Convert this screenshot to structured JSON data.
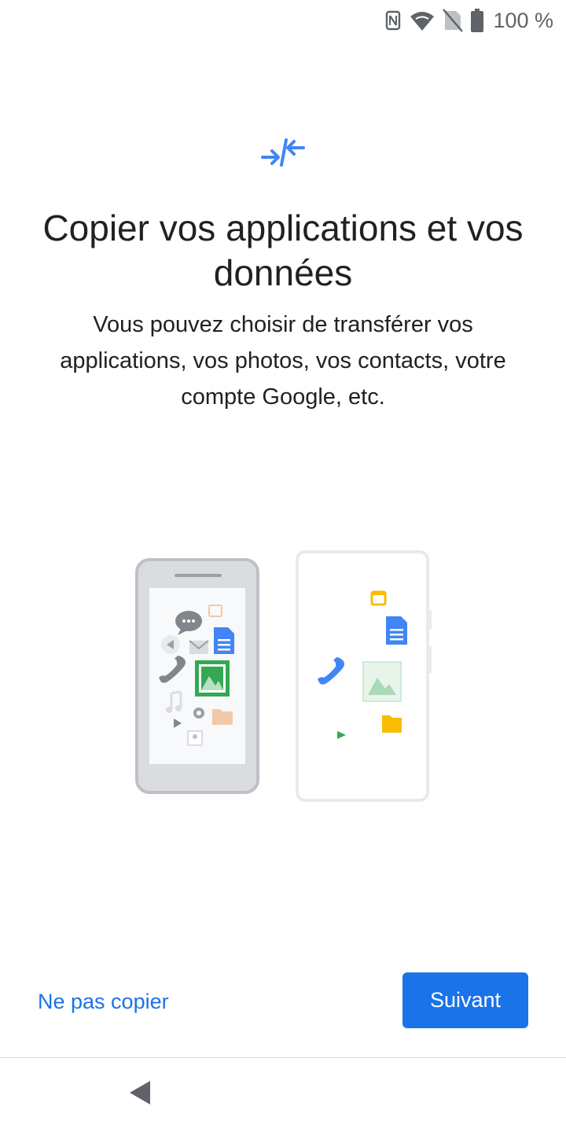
{
  "status_bar": {
    "battery_text": "100 %",
    "icons": [
      "nfc-icon",
      "wifi-icon",
      "no-sim-icon",
      "battery-icon"
    ]
  },
  "header": {
    "icon": "transfer-arrows-icon",
    "title": "Copier vos applications et vos données",
    "subtitle": "Vous pouvez choisir de transférer vos applications, vos photos, vos contacts, votre compte Google, etc."
  },
  "illustration": {
    "icon": "phone-transfer-illustration"
  },
  "actions": {
    "skip_label": "Ne pas copier",
    "next_label": "Suivant"
  },
  "navigation": {
    "back_icon": "back-triangle-icon"
  },
  "colors": {
    "accent": "#1a73e8",
    "text_primary": "#202124",
    "status_icon": "#5f6368"
  }
}
